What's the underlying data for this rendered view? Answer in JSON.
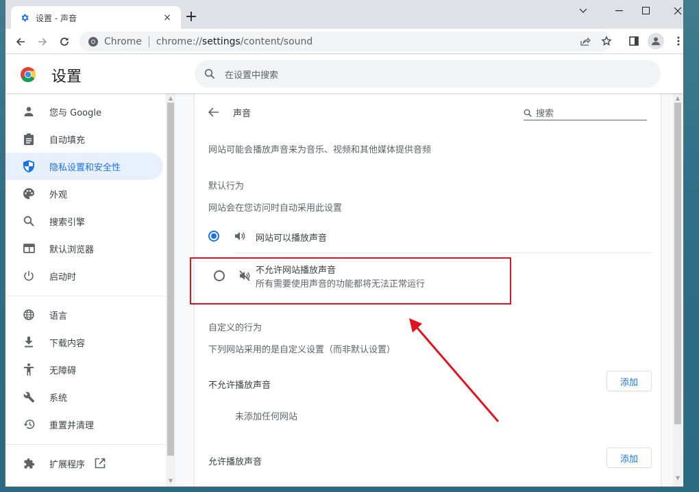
{
  "browser": {
    "tab": {
      "title": "设置 - 声音",
      "favicon": "gear-icon",
      "close": "×"
    },
    "new_tab": "+",
    "window_controls": [
      "tab-search",
      "minimize",
      "maximize",
      "close"
    ],
    "omnibox": {
      "site_label": "Chrome",
      "url_prefix": "chrome://",
      "url_host": "settings",
      "url_path": "/content/sound"
    },
    "toolbar_icons": [
      "back-icon",
      "forward-icon",
      "reload-icon",
      "share-icon",
      "bookmark-star-icon",
      "side-panel-icon",
      "profile-icon",
      "menu-icon"
    ]
  },
  "settings": {
    "title": "设置",
    "search_placeholder": "在设置中搜索"
  },
  "sidebar": {
    "items": [
      {
        "label": "您与 Google",
        "icon": "person-icon",
        "active": false
      },
      {
        "label": "自动填充",
        "icon": "clipboard-icon",
        "active": false
      },
      {
        "label": "隐私设置和安全性",
        "icon": "shield-icon",
        "active": true
      },
      {
        "label": "外观",
        "icon": "palette-icon",
        "active": false
      },
      {
        "label": "搜索引擎",
        "icon": "search-icon",
        "active": false
      },
      {
        "label": "默认浏览器",
        "icon": "browser-icon",
        "active": false
      },
      {
        "label": "启动时",
        "icon": "power-icon",
        "active": false
      },
      {
        "label": "语言",
        "icon": "globe-icon",
        "active": false
      },
      {
        "label": "下载内容",
        "icon": "download-icon",
        "active": false
      },
      {
        "label": "无障碍",
        "icon": "accessibility-icon",
        "active": false
      },
      {
        "label": "系统",
        "icon": "wrench-icon",
        "active": false
      },
      {
        "label": "重置并清理",
        "icon": "history-icon",
        "active": false
      },
      {
        "label": "扩展程序",
        "icon": "puzzle-icon",
        "active": false,
        "external": true
      }
    ]
  },
  "page": {
    "title": "声音",
    "search_placeholder": "搜索",
    "description": "网站可能会播放声音来为音乐、视频和其他媒体提供音频",
    "default_behavior": {
      "heading": "默认行为",
      "subheading": "网站会在您访问时自动采用此设置",
      "options": [
        {
          "label": "网站可以播放声音",
          "description": "",
          "selected": true,
          "icon": "volume-icon"
        },
        {
          "label": "不允许网站播放声音",
          "description": "所有需要使用声音的功能都将无法正常运行",
          "selected": false,
          "icon": "volume-off-icon"
        }
      ]
    },
    "custom_behavior": {
      "heading": "自定义的行为",
      "subheading": "下列网站采用的是自定义设置（而非默认设置）",
      "blocked": {
        "label": "不允许播放声音",
        "add_button": "添加",
        "empty_text": "未添加任何网站"
      },
      "allowed": {
        "label": "允许播放声音",
        "add_button": "添加"
      }
    }
  },
  "annotation": {
    "box_color": "#e0141e",
    "arrow_color": "#e0141e"
  }
}
